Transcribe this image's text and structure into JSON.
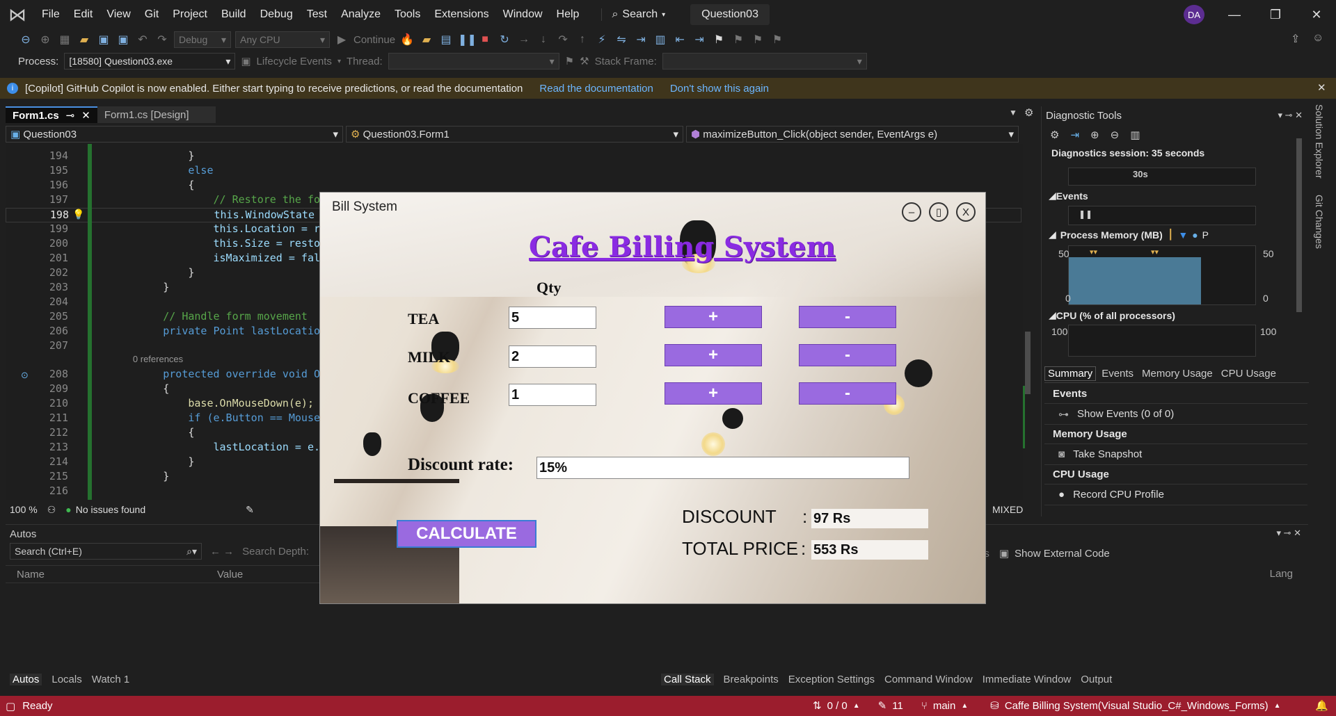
{
  "menubar": {
    "items": [
      "File",
      "Edit",
      "View",
      "Git",
      "Project",
      "Build",
      "Debug",
      "Test",
      "Analyze",
      "Tools",
      "Extensions",
      "Window",
      "Help"
    ],
    "search": "Search",
    "solution": "Question03",
    "avatar": "DA"
  },
  "toolbar": {
    "config": "Debug",
    "platform": "Any CPU",
    "continue": "Continue"
  },
  "debugbar": {
    "process_label": "Process:",
    "process_value": "[18580] Question03.exe",
    "lifecycle": "Lifecycle Events",
    "thread_label": "Thread:",
    "stackframe_label": "Stack Frame:"
  },
  "infobar": {
    "message": "[Copilot] GitHub Copilot is now enabled. Either start typing to receive predictions, or read the documentation",
    "link1": "Read the documentation",
    "link2": "Don't show this again"
  },
  "tabs": [
    {
      "label": "Form1.cs"
    },
    {
      "label": "Form1.cs [Design]"
    }
  ],
  "nav": {
    "project": "Question03",
    "class": "Question03.Form1",
    "member": "maximizeButton_Click(object sender, EventArgs e)"
  },
  "code": {
    "lines": [
      {
        "n": "194",
        "t": "            }"
      },
      {
        "n": "195",
        "t": "            else"
      },
      {
        "n": "196",
        "t": "            {"
      },
      {
        "n": "197",
        "t": "                // Restore the fo"
      },
      {
        "n": "198",
        "t": "                this.WindowState"
      },
      {
        "n": "199",
        "t": "                this.Location = r"
      },
      {
        "n": "200",
        "t": "                this.Size = resto"
      },
      {
        "n": "201",
        "t": "                isMaximized = fal"
      },
      {
        "n": "202",
        "t": "            }"
      },
      {
        "n": "203",
        "t": "        }"
      },
      {
        "n": "204",
        "t": ""
      },
      {
        "n": "205",
        "t": "        // Handle form movement"
      },
      {
        "n": "206",
        "t": "        private Point lastLocatio"
      },
      {
        "n": "207",
        "t": ""
      },
      {
        "n": "",
        "t": "        0 references"
      },
      {
        "n": "208",
        "t": "        protected override void O"
      },
      {
        "n": "209",
        "t": "        {"
      },
      {
        "n": "210",
        "t": "            base.OnMouseDown(e);"
      },
      {
        "n": "211",
        "t": "            if (e.Button == Mouse"
      },
      {
        "n": "212",
        "t": "            {"
      },
      {
        "n": "213",
        "t": "                lastLocation = e."
      },
      {
        "n": "214",
        "t": "            }"
      },
      {
        "n": "215",
        "t": "        }"
      },
      {
        "n": "216",
        "t": ""
      }
    ]
  },
  "editor_status": {
    "zoom": "100 %",
    "issues": "No issues found",
    "encoding": "MIXED"
  },
  "diagnostics": {
    "title": "Diagnostic Tools",
    "session": "Diagnostics session: 35 seconds",
    "timeline_tick": "30s",
    "events": "Events",
    "process_memory": "Process Memory (MB)",
    "mem_snapshot_letter": "P",
    "mem_max": "50",
    "mem_min": "0",
    "cpu": "CPU (% of all processors)",
    "cpu_max": "100",
    "tabs": [
      "Summary",
      "Events",
      "Memory Usage",
      "CPU Usage"
    ],
    "summary": {
      "events_head": "Events",
      "events_row": "Show Events (0 of 0)",
      "memory_head": "Memory Usage",
      "memory_row": "Take Snapshot",
      "cpu_head": "CPU Usage",
      "cpu_row": "Record CPU Profile"
    }
  },
  "sidetabs": [
    "Solution Explorer",
    "Git Changes"
  ],
  "autos": {
    "title": "Autos",
    "search_placeholder": "Search (Ctrl+E)",
    "search_depth": "Search Depth:",
    "col_name": "Name",
    "col_value": "Value",
    "tabs": [
      "Autos",
      "Locals",
      "Watch 1"
    ]
  },
  "callstack": {
    "ds_fragment": "ds",
    "show_external": "Show External Code",
    "col_lang": "Lang",
    "tabs": [
      "Call Stack",
      "Breakpoints",
      "Exception Settings",
      "Command Window",
      "Immediate Window",
      "Output"
    ]
  },
  "statusbar": {
    "ready": "Ready",
    "errors": "0 / 0",
    "changes": "11",
    "branch": "main",
    "repo": "Caffe Billing System(Visual Studio_C#_Windows_Forms)"
  },
  "form": {
    "window_title": "Bill System",
    "title": "Cafe Billing System",
    "qty_header": "Qty",
    "items": [
      {
        "label": "TEA",
        "qty": "5"
      },
      {
        "label": "MILK",
        "qty": "2"
      },
      {
        "label": "COFFEE",
        "qty": "1"
      }
    ],
    "plus": "+",
    "minus": "-",
    "discount_label": "Discount rate:",
    "discount_value": "15%",
    "calculate": "CALCULATE",
    "discount_result_label": "DISCOUNT",
    "discount_result_value": "97 Rs",
    "total_label": "TOTAL PRICE",
    "total_value": "553 Rs",
    "colon": ":",
    "ctrl_min": "–",
    "ctrl_max": "▯",
    "ctrl_close": "X"
  },
  "colors": {
    "accent_purple": "#8a2be2",
    "button_purple": "#9a6ae0",
    "statusbar": "#9b1d2d",
    "infobar": "#3f351c"
  }
}
